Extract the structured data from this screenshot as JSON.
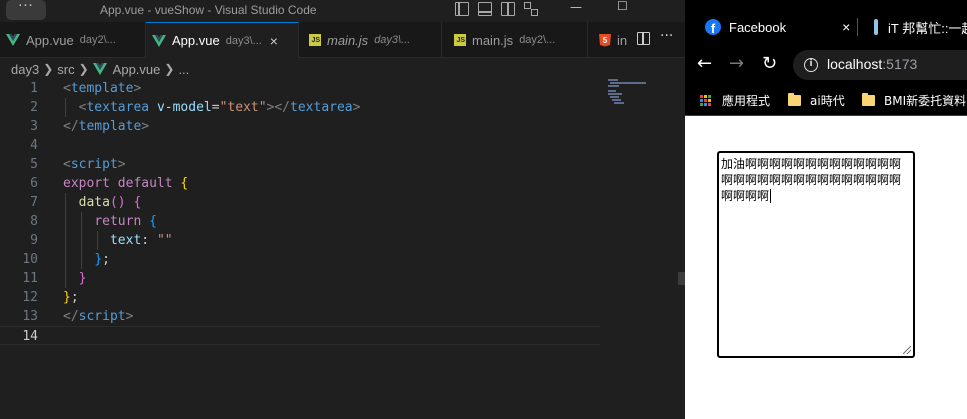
{
  "vscode": {
    "menu_label": "···",
    "title": "App.vue - vueShow - Visual Studio Code",
    "window_controls": {
      "minimize": "—",
      "maximize": "☐"
    },
    "tabs": [
      {
        "name": "App.vue",
        "desc": "day2\\...",
        "icon": "vue-icon",
        "active": false,
        "italic": false
      },
      {
        "name": "App.vue",
        "desc": "day3\\...",
        "icon": "vue-icon",
        "active": true,
        "italic": false,
        "close": "×"
      },
      {
        "name": "main.js",
        "desc": "day3\\...",
        "icon": "js-icon",
        "active": false,
        "italic": true
      },
      {
        "name": "main.js",
        "desc": "day2\\...",
        "icon": "js-icon",
        "active": false,
        "italic": false
      },
      {
        "name": "in",
        "desc": "",
        "icon": "html-icon",
        "active": false,
        "italic": false
      }
    ],
    "icon_labels": {
      "js": "JS",
      "html": "5"
    },
    "more_actions": "···",
    "breadcrumb": [
      "day3",
      "src",
      "App.vue",
      "..."
    ],
    "active_line": 14,
    "code_lines": [
      {
        "n": 1,
        "tokens": [
          [
            "t-tag",
            "<"
          ],
          [
            "t-name",
            "template"
          ],
          [
            "t-tag",
            ">"
          ]
        ]
      },
      {
        "n": 2,
        "tokens": [
          [
            "t-punct",
            "  "
          ],
          [
            "t-tag",
            "<"
          ],
          [
            "t-name",
            "textarea"
          ],
          [
            "t-punct",
            " "
          ],
          [
            "t-attr",
            "v-model"
          ],
          [
            "t-punct",
            "="
          ],
          [
            "t-str",
            "\"text\""
          ],
          [
            "t-tag",
            "></"
          ],
          [
            "t-name",
            "textarea"
          ],
          [
            "t-tag",
            ">"
          ]
        ]
      },
      {
        "n": 3,
        "tokens": [
          [
            "t-tag",
            "</"
          ],
          [
            "t-name",
            "template"
          ],
          [
            "t-tag",
            ">"
          ]
        ]
      },
      {
        "n": 4,
        "tokens": []
      },
      {
        "n": 5,
        "tokens": [
          [
            "t-tag",
            "<"
          ],
          [
            "t-name",
            "script"
          ],
          [
            "t-tag",
            ">"
          ]
        ]
      },
      {
        "n": 6,
        "tokens": [
          [
            "t-kw",
            "export"
          ],
          [
            "t-punct",
            " "
          ],
          [
            "t-kw",
            "default"
          ],
          [
            "t-punct",
            " "
          ],
          [
            "t-b1",
            "{"
          ]
        ]
      },
      {
        "n": 7,
        "tokens": [
          [
            "t-punct",
            "  "
          ],
          [
            "t-fn",
            "data"
          ],
          [
            "t-b2",
            "()"
          ],
          [
            "t-punct",
            " "
          ],
          [
            "t-b2",
            "{"
          ]
        ]
      },
      {
        "n": 8,
        "tokens": [
          [
            "t-punct",
            "    "
          ],
          [
            "t-kw",
            "return"
          ],
          [
            "t-punct",
            " "
          ],
          [
            "t-b3",
            "{"
          ]
        ]
      },
      {
        "n": 9,
        "tokens": [
          [
            "t-punct",
            "      "
          ],
          [
            "t-prop",
            "text"
          ],
          [
            "t-punct",
            ": "
          ],
          [
            "t-str",
            "\"\""
          ]
        ]
      },
      {
        "n": 10,
        "tokens": [
          [
            "t-punct",
            "    "
          ],
          [
            "t-b3",
            "}"
          ],
          [
            "t-punct",
            ";"
          ]
        ]
      },
      {
        "n": 11,
        "tokens": [
          [
            "t-punct",
            "  "
          ],
          [
            "t-b2",
            "}"
          ]
        ]
      },
      {
        "n": 12,
        "tokens": [
          [
            "t-b1",
            "}"
          ],
          [
            "t-punct",
            ";"
          ]
        ]
      },
      {
        "n": 13,
        "tokens": [
          [
            "t-tag",
            "</"
          ],
          [
            "t-name",
            "script"
          ],
          [
            "t-tag",
            ">"
          ]
        ]
      },
      {
        "n": 14,
        "tokens": []
      }
    ]
  },
  "chrome": {
    "tabs": [
      {
        "title": "Facebook",
        "icon": "facebook-icon",
        "icon_label": "f",
        "close": "×"
      },
      {
        "title": "iT 邦幫忙::一起",
        "icon": "ithome-icon"
      }
    ],
    "nav": {
      "back": "←",
      "forward": "→",
      "reload": "↻"
    },
    "info_label": "i",
    "url_host": "localhost",
    "url_port": ":5173",
    "bookmarks": [
      "應用程式",
      "ai時代",
      "BMI新委托資料"
    ],
    "textarea_value": "加油啊啊啊啊啊啊啊啊啊啊啊啊啊啊啊啊啊啊啊啊啊啊啊啊啊啊啊啊啊啊啊啊"
  },
  "colors": {
    "vscode_bg": "#1f1f1f",
    "accent": "#0078d4",
    "facebook": "#1877f2",
    "apps_grid": [
      "#ea4335",
      "#fbbc05",
      "#34a853",
      "#4285f4",
      "#ea4335",
      "#fbbc05",
      "#34a853",
      "#4285f4",
      "#ea4335"
    ]
  }
}
